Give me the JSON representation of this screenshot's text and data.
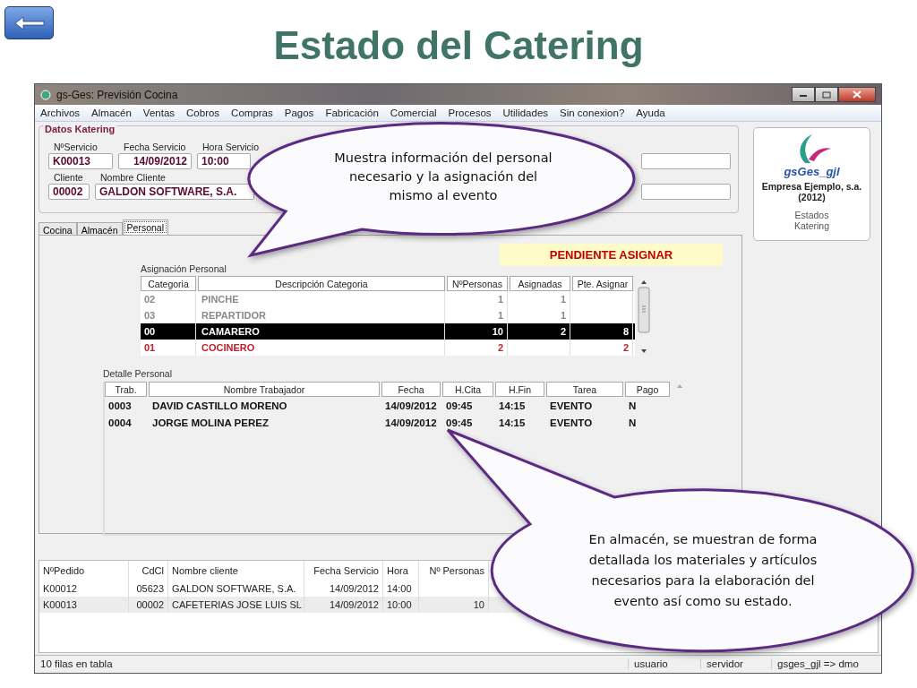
{
  "slide": {
    "title": "Estado del Catering"
  },
  "window": {
    "title": "gs-Ges: Previsión Cocina"
  },
  "menu": [
    "Archivos",
    "Almacén",
    "Ventas",
    "Cobros",
    "Compras",
    "Pagos",
    "Fabricación",
    "Comercial",
    "Procesos",
    "Utilidades",
    "Sin conexion?",
    "Ayuda"
  ],
  "datos_katering": {
    "legend": "Datos Katering",
    "row_1": [
      {
        "label": "NºServicio",
        "value": "K00013"
      },
      {
        "label": "Fecha Servicio",
        "value": "14/09/2012"
      },
      {
        "label": "Hora Servicio",
        "value": "10:00"
      }
    ],
    "row_2": [
      {
        "label": "Cliente",
        "value": "00002"
      },
      {
        "label": "Nombre Cliente",
        "value": "GALDON SOFTWARE, S.A."
      }
    ]
  },
  "company_panel": {
    "name": "gsGes_gjl",
    "company": "Empresa Ejemplo, s.a.",
    "year": "(2012)",
    "link": "Estados Katering"
  },
  "tabs": [
    {
      "label": "Cocina",
      "selected": false
    },
    {
      "label": "Almacén",
      "selected": false
    },
    {
      "label": "Personal",
      "selected": true
    }
  ],
  "status_badge": "PENDIENTE ASIGNAR",
  "asignacion": {
    "title": "Asignación Personal",
    "columns": [
      "Categoria",
      "Descripción Categoria",
      "NºPersonas",
      "Asignadas",
      "Pte. Asignar"
    ],
    "rows": [
      {
        "cells": [
          "02",
          "PINCHE",
          "1",
          "1"
        ],
        "fully_assigned": true,
        "selected": false
      },
      {
        "cells": [
          "03",
          "REPARTIDOR",
          "1",
          "1"
        ],
        "fully_assigned": true,
        "selected": false
      },
      {
        "cells": [
          "00",
          "CAMARERO",
          "10",
          "2",
          "8"
        ],
        "fully_assigned": false,
        "selected": true
      },
      {
        "cells": [
          "01",
          "COCINERO",
          "2",
          "",
          "2"
        ],
        "fully_assigned": false,
        "selected": false
      }
    ]
  },
  "detalle": {
    "title": "Detalle Personal",
    "columns": [
      "Trab.",
      "Nombre Trabajador",
      "Fecha",
      "H.Cita",
      "H.Fin",
      "Tarea",
      "Pago"
    ],
    "rows": [
      [
        "0003",
        "DAVID CASTILLO MORENO",
        "14/09/2012",
        "09:45",
        "14:15",
        "EVENTO",
        "N"
      ],
      [
        "0004",
        "JORGE MOLINA PEREZ",
        "14/09/2012",
        "09:45",
        "14:15",
        "EVENTO",
        "N"
      ]
    ]
  },
  "pedidos": {
    "columns": [
      "NºPedido",
      "CdCl",
      "Nombre cliente",
      "Fecha Servicio",
      "Hora",
      "Nº Personas"
    ],
    "rows": [
      {
        "pedido": "K00012",
        "cdcl": "05623",
        "cliente": "GALDON SOFTWARE, S.A.",
        "fecha": "14/09/2012",
        "hora": "14:00"
      },
      {
        "pedido": "K00013",
        "cdcl": "00002",
        "cliente": "CAFETERIAS JOSE LUIS SL",
        "fecha": "14/09/2012",
        "hora": "10:00",
        "personas": "10"
      }
    ]
  },
  "status_bar": [
    "10 filas en tabla",
    "usuario",
    "servidor",
    "gsges_gjl => dmo"
  ],
  "callouts": [
    {
      "text": "Muestra información del personal\nnecesario y la asignación del\nmismo al evento"
    },
    {
      "text": "En almacén, se muestran de forma\ndetallada los materiales y artículos\nnecesarios para la elaboración del\nevento así como su estado."
    }
  ]
}
